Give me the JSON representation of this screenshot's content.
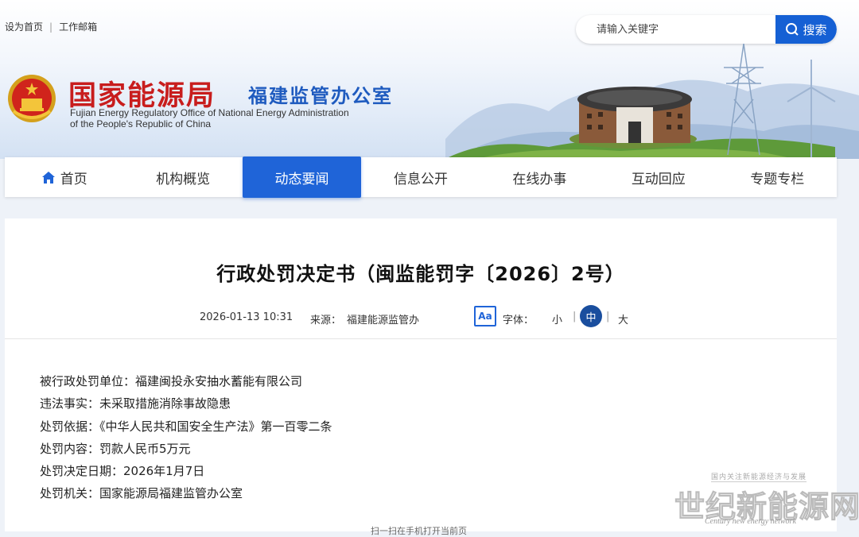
{
  "top_links": {
    "homepage": "设为首页",
    "mail": "工作邮箱"
  },
  "search": {
    "placeholder": "请输入关键字",
    "button": "搜索"
  },
  "site": {
    "name": "国家能源局",
    "subtitle": "福建监管办公室",
    "english_line1": "Fujian Energy Regulatory Office of National Energy Administration",
    "english_line2": "of the People's Republic of China"
  },
  "nav": {
    "items": [
      {
        "label": "首页"
      },
      {
        "label": "机构概览"
      },
      {
        "label": "动态要闻"
      },
      {
        "label": "信息公开"
      },
      {
        "label": "在线办事"
      },
      {
        "label": "互动回应"
      },
      {
        "label": "专题专栏"
      }
    ],
    "active_index": 2
  },
  "article": {
    "title": "行政处罚决定书（闽监能罚字〔2026〕2号）",
    "date": "2026-01-13 10:31",
    "source_label": "来源：",
    "source": "福建能源监管办",
    "font_icon": "Aa",
    "font_label": "字体：",
    "font_sizes": {
      "small": "小",
      "medium": "中",
      "large": "大"
    },
    "font_selected": "medium",
    "lines": [
      "被行政处罚单位：福建闽投永安抽水蓄能有限公司",
      "违法事实：未采取措施消除事故隐患",
      "处罚依据：《中华人民共和国安全生产法》第一百零二条",
      "处罚内容：罚款人民币5万元",
      "处罚决定日期：2026年1月7日",
      "处罚机关：国家能源局福建监管办公室"
    ],
    "bottom_hint": "扫一扫在手机打开当前页"
  },
  "watermark": {
    "tagline": "国内关注新能源经济与发展",
    "name": "世纪新能源网",
    "english": "Century new energy network"
  },
  "colors": {
    "brand_red": "#c81d1d",
    "brand_blue": "#1f5bbf",
    "nav_active": "#1f64d8",
    "search_button": "#1560d4"
  }
}
